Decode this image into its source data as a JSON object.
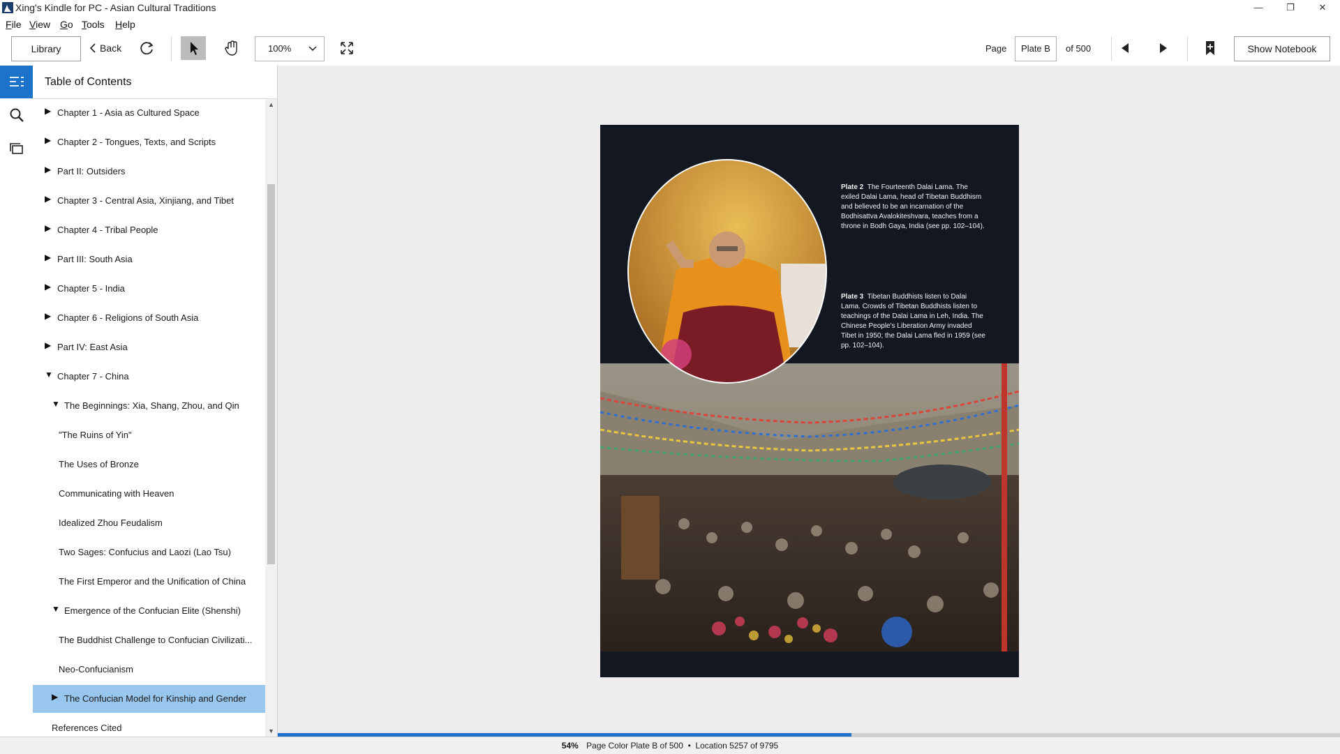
{
  "window": {
    "title": "Xing's Kindle for PC - Asian Cultural Traditions",
    "controls": {
      "minimize": "—",
      "maximize": "❐",
      "close": "✕"
    }
  },
  "menu": {
    "items": [
      {
        "first": "F",
        "rest": "ile"
      },
      {
        "first": "V",
        "rest": "iew"
      },
      {
        "first": "G",
        "rest": "o"
      },
      {
        "first": "T",
        "rest": "ools"
      },
      {
        "first": "H",
        "rest": "elp"
      }
    ]
  },
  "toolbar": {
    "library_label": "Library",
    "back_label": "Back",
    "zoom_value": "100%",
    "page_label": "Page",
    "page_value": "Plate B",
    "page_of": "of 500",
    "notebook_label": "Show Notebook"
  },
  "toc": {
    "title": "Table of Contents",
    "items": [
      {
        "label": "Chapter 1 - Asia as Cultured Space",
        "tri": "▶",
        "level": 0
      },
      {
        "label": "Chapter 2 - Tongues, Texts, and Scripts",
        "tri": "▶",
        "level": 0
      },
      {
        "label": "Part II: Outsiders",
        "tri": "▶",
        "level": 0
      },
      {
        "label": "Chapter 3 - Central Asia, Xinjiang, and Tibet",
        "tri": "▶",
        "level": 0
      },
      {
        "label": "Chapter 4 - Tribal People",
        "tri": "▶",
        "level": 0
      },
      {
        "label": "Part III: South Asia",
        "tri": "▶",
        "level": 0
      },
      {
        "label": "Chapter 5 - India",
        "tri": "▶",
        "level": 0
      },
      {
        "label": "Chapter 6 - Religions of South Asia",
        "tri": "▶",
        "level": 0
      },
      {
        "label": "Part IV: East Asia",
        "tri": "▶",
        "level": 0
      },
      {
        "label": "Chapter 7 - China",
        "tri": "▼",
        "level": 0
      },
      {
        "label": "The Beginnings: Xia, Shang, Zhou, and Qin",
        "tri": "▼",
        "level": 1
      },
      {
        "label": "\"The Ruins of Yin\"",
        "tri": "",
        "level": 2
      },
      {
        "label": "The Uses of Bronze",
        "tri": "",
        "level": 2
      },
      {
        "label": "Communicating with Heaven",
        "tri": "",
        "level": 2
      },
      {
        "label": "Idealized Zhou Feudalism",
        "tri": "",
        "level": 2
      },
      {
        "label": "Two Sages: Confucius and Laozi (Lao Tsu)",
        "tri": "",
        "level": 2
      },
      {
        "label": "The First Emperor and the Unification of China",
        "tri": "",
        "level": 2
      },
      {
        "label": "Emergence of the Confucian Elite (Shenshi)",
        "tri": "▼",
        "level": 1
      },
      {
        "label": "The Buddhist Challenge to Confucian Civilizati...",
        "tri": "",
        "level": 2
      },
      {
        "label": "Neo-Confucianism",
        "tri": "",
        "level": 2
      },
      {
        "label": "The Confucian Model for Kinship and Gender",
        "tri": "▶",
        "level": 1,
        "selected": true
      },
      {
        "label": "References Cited",
        "tri": "",
        "level": 1.5
      }
    ]
  },
  "book_page": {
    "caption1_title": "Plate 2",
    "caption1_body": "The Fourteenth Dalai Lama. The exiled Dalai Lama, head of Tibetan Buddhism and believed to be an incarnation of the Bodhisattva Avalokiteshvara, teaches from a throne in Bodh Gaya, India (see pp. 102–104).",
    "caption2_title": "Plate 3",
    "caption2_body": "Tibetan Buddhists listen to Dalai Lama. Crowds of Tibetan Buddhists listen to teachings of the Dalai Lama in Leh, India. The Chinese People's Liberation Army invaded Tibet in 1950; the Dalai Lama fled in 1959 (see pp. 102–104)."
  },
  "status": {
    "percent": "54%",
    "progress_fraction": 0.54,
    "page_color": "Page Color Plate B of 500",
    "separator": "•",
    "location": "Location 5257 of 9795"
  },
  "colors": {
    "accent": "#1d73c9",
    "selection": "#99c6ec"
  },
  "icons": [
    "kindle-app-icon",
    "chevron-left-icon",
    "sync-icon",
    "pointer-icon",
    "hand-icon",
    "chevron-down-icon",
    "fullscreen-icon",
    "prev-page-icon",
    "next-page-icon",
    "bookmark-add-icon",
    "toc-icon",
    "search-icon",
    "flashcards-icon"
  ]
}
